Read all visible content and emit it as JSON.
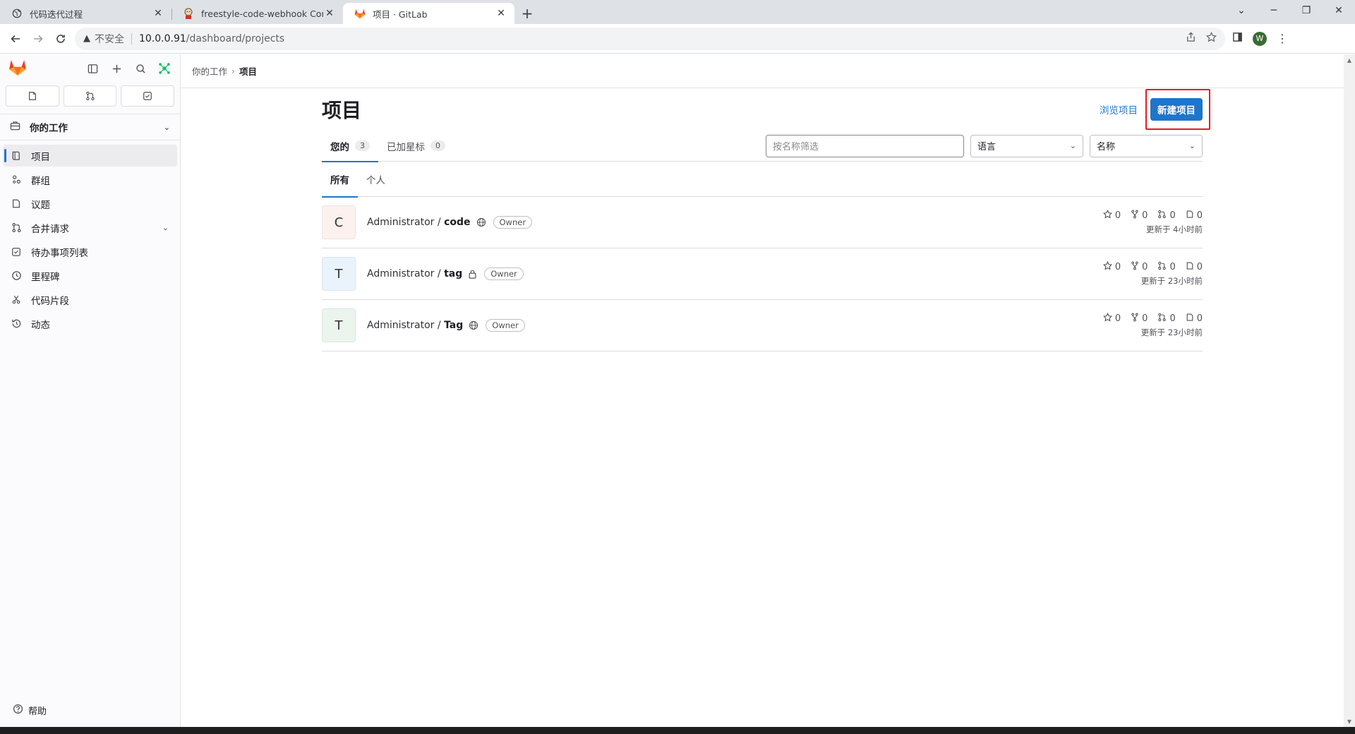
{
  "browser": {
    "tabs": [
      {
        "title": "代码迭代过程",
        "close": "✕",
        "icon": "globe-icon"
      },
      {
        "title": "freestyle-code-webhook Config",
        "close": "✕",
        "icon": "jenkins-icon"
      },
      {
        "title": "项目 · GitLab",
        "close": "✕",
        "icon": "gitlab-icon"
      }
    ],
    "new_tab": "+",
    "address": {
      "insecure_label": "不安全",
      "host": "10.0.0.91",
      "path": "/dashboard/projects"
    },
    "profile_initial": "W"
  },
  "sidebar": {
    "counts": [
      "issues-icon",
      "merge-requests-icon",
      "todo-icon"
    ],
    "context_label": "你的工作",
    "items": [
      {
        "label": "项目",
        "icon": "project-icon",
        "active": true
      },
      {
        "label": "群组",
        "icon": "group-icon"
      },
      {
        "label": "议题",
        "icon": "issues-icon"
      },
      {
        "label": "合并请求",
        "icon": "merge-request-icon",
        "expandable": true
      },
      {
        "label": "待办事项列表",
        "icon": "todo-icon"
      },
      {
        "label": "里程碑",
        "icon": "milestone-icon"
      },
      {
        "label": "代码片段",
        "icon": "snippet-icon"
      },
      {
        "label": "动态",
        "icon": "history-icon"
      }
    ],
    "help_label": "帮助"
  },
  "breadcrumb": {
    "root": "你的工作",
    "current": "项目"
  },
  "page": {
    "title": "项目",
    "explore_label": "浏览项目",
    "new_project_label": "新建项目"
  },
  "tabs": [
    {
      "label": "您的",
      "count": "3"
    },
    {
      "label": "已加星标",
      "count": "0"
    }
  ],
  "filters": {
    "search_placeholder": "按名称筛选",
    "language_label": "语言",
    "sort_label": "名称"
  },
  "subtabs": [
    {
      "label": "所有"
    },
    {
      "label": "个人"
    }
  ],
  "projects": [
    {
      "initial": "C",
      "namespace": "Administrator / ",
      "name": "code",
      "visibility": "public",
      "role": "Owner",
      "stars": "0",
      "forks": "0",
      "merge_requests": "0",
      "issues": "0",
      "updated": "更新于 4小时前",
      "avatar_color": "#fcf1ef"
    },
    {
      "initial": "T",
      "namespace": "Administrator / ",
      "name": "tag",
      "visibility": "private",
      "role": "Owner",
      "stars": "0",
      "forks": "0",
      "merge_requests": "0",
      "issues": "0",
      "updated": "更新于 23小时前",
      "avatar_color": "#e9f3fc"
    },
    {
      "initial": "T",
      "namespace": "Administrator / ",
      "name": "Tag",
      "visibility": "public",
      "role": "Owner",
      "stars": "0",
      "forks": "0",
      "merge_requests": "0",
      "issues": "0",
      "updated": "更新于 23小时前",
      "avatar_color": "#ecf4ee"
    }
  ],
  "colors": {
    "accent": "#1f75cb",
    "highlight_box": "#e11d21"
  }
}
